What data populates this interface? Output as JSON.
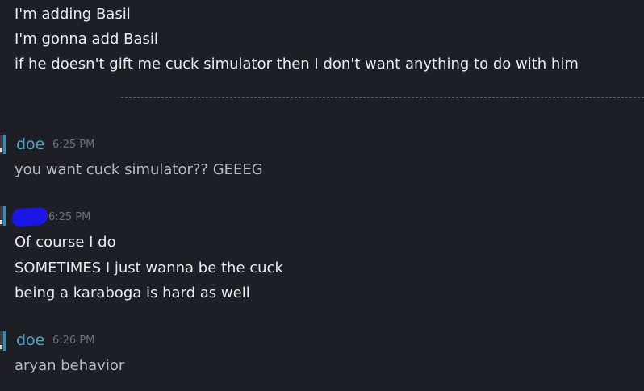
{
  "top_block": {
    "lines": [
      "I'm adding Basil",
      "I'm gonna add Basil",
      "if he doesn't gift me cuck simulator then I don't want anything to do with him"
    ]
  },
  "messages": [
    {
      "sender": "doe",
      "time": "6:25 PM",
      "lines": [
        "you want cuck simulator?? GEEEG"
      ]
    },
    {
      "sender": "",
      "time": "6:25 PM",
      "lines": [
        "Of course I do",
        "SOMETIMES I just wanna be the cuck",
        "being a karaboga is hard as well"
      ]
    },
    {
      "sender": "doe",
      "time": "6:26 PM",
      "lines": [
        "aryan behavior"
      ]
    }
  ],
  "colors": {
    "background": "#1d1f24",
    "sender_name": "#4fa3bd",
    "timestamp": "#6a6f76",
    "self_text": "#e8eaed",
    "other_text": "#b6bac0",
    "new_messages_divider": "#3a6a6c",
    "redaction_scribble": "#1b16e6"
  }
}
